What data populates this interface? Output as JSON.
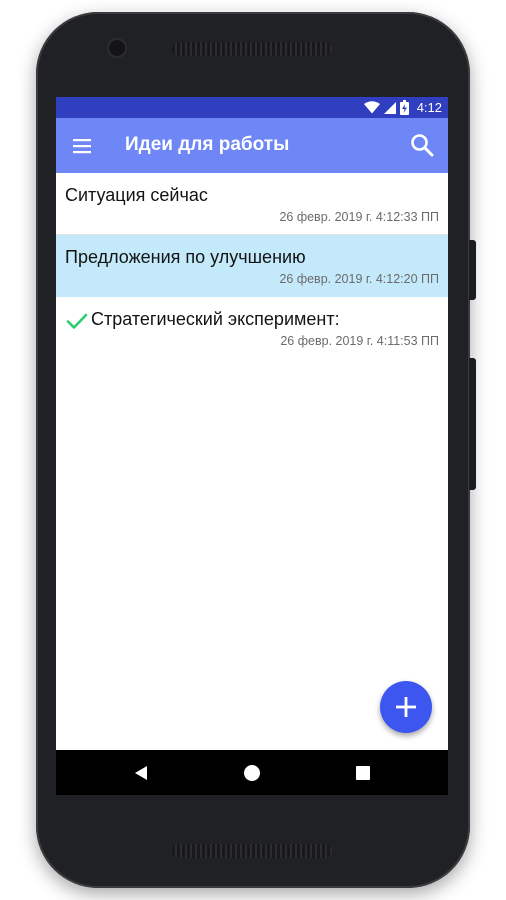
{
  "status_bar": {
    "time": "4:12",
    "icons": [
      "wifi-icon",
      "cell-signal-icon",
      "battery-charging-icon"
    ],
    "color": "#2f3fbf"
  },
  "app_bar": {
    "title": "Идеи для работы",
    "menu_icon": "hamburger-menu-icon",
    "search_icon": "search-icon",
    "color": "#6f86f6"
  },
  "items": [
    {
      "title": "Ситуация сейчас",
      "date": "26 февр. 2019 г. 4:12:33 ПП",
      "selected": false,
      "done": false
    },
    {
      "title": "Предложения по улучшению",
      "date": "26 февр. 2019 г. 4:12:20 ПП",
      "selected": true,
      "done": false
    },
    {
      "title": "Стратегический эксперимент:",
      "date": "26 февр. 2019 г. 4:11:53 ПП",
      "selected": false,
      "done": true
    }
  ],
  "fab": {
    "icon": "plus-icon",
    "color": "#3d56f0"
  },
  "nav_bar": {
    "icons": [
      "back-triangle-icon",
      "home-circle-icon",
      "recents-square-icon"
    ]
  },
  "colors": {
    "selected_row": "#c3e9fa",
    "check": "#2ecc71"
  }
}
